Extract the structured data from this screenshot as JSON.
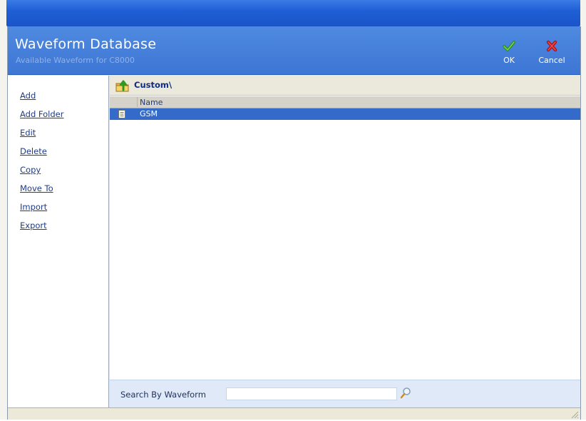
{
  "header": {
    "title": "Waveform Database",
    "subtitle": "Available Waveform for C8000",
    "ok_label": "OK",
    "cancel_label": "Cancel"
  },
  "sidebar": {
    "items": [
      {
        "label": "Add"
      },
      {
        "label": "Add Folder"
      },
      {
        "label": "Edit"
      },
      {
        "label": "Delete"
      },
      {
        "label": "Copy"
      },
      {
        "label": "Move To"
      },
      {
        "label": "Import"
      },
      {
        "label": "Export"
      }
    ]
  },
  "browser": {
    "path": "Custom\\",
    "columns": [
      "Name"
    ],
    "rows": [
      {
        "name": "GSM",
        "selected": true
      }
    ]
  },
  "search": {
    "label": "Search By Waveform",
    "value": "",
    "placeholder": ""
  },
  "icons": {
    "ok": "checkmark-icon",
    "cancel": "x-icon",
    "folder_up": "folder-up-icon",
    "file": "document-icon",
    "search": "magnifier-icon"
  },
  "colors": {
    "header": "#3d76d4",
    "selection": "#346ac9",
    "link": "#1f3c8a"
  }
}
